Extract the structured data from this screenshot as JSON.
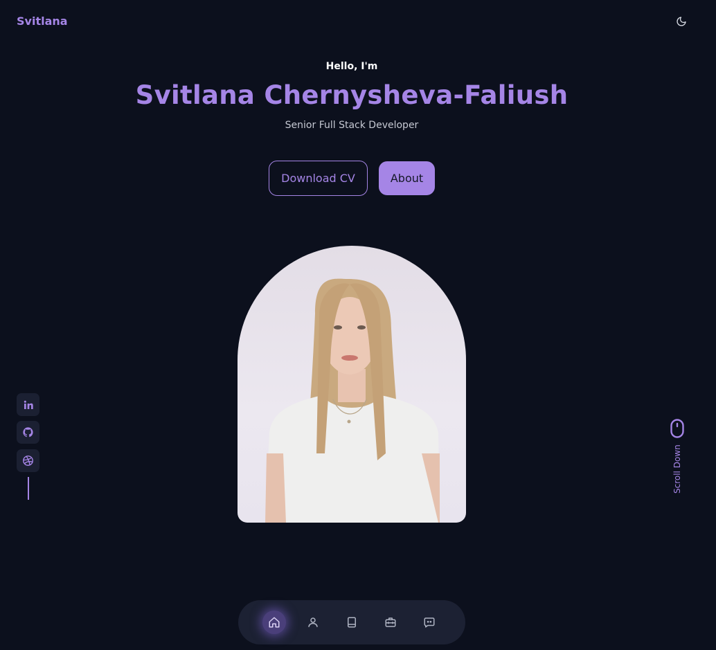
{
  "header": {
    "logo": "Svitlana",
    "theme_icon": "moon-icon"
  },
  "hero": {
    "greeting": "Hello, I'm",
    "name": "Svitlana Chernysheva-Faliush",
    "role": "Senior Full Stack Developer",
    "download_cv_label": "Download CV",
    "about_label": "About"
  },
  "social": {
    "items": [
      {
        "icon": "linkedin-icon"
      },
      {
        "icon": "github-icon"
      },
      {
        "icon": "dribbble-icon"
      }
    ]
  },
  "scroll": {
    "label": "Scroll Down",
    "icon": "mouse-icon"
  },
  "nav": {
    "items": [
      {
        "icon": "home-icon",
        "active": true
      },
      {
        "icon": "user-icon",
        "active": false
      },
      {
        "icon": "book-icon",
        "active": false
      },
      {
        "icon": "briefcase-icon",
        "active": false
      },
      {
        "icon": "message-icon",
        "active": false
      }
    ]
  },
  "colors": {
    "background": "#0c101d",
    "accent": "#a585e6",
    "surface": "#1c2133",
    "active_nav": "#4a3f7a"
  }
}
